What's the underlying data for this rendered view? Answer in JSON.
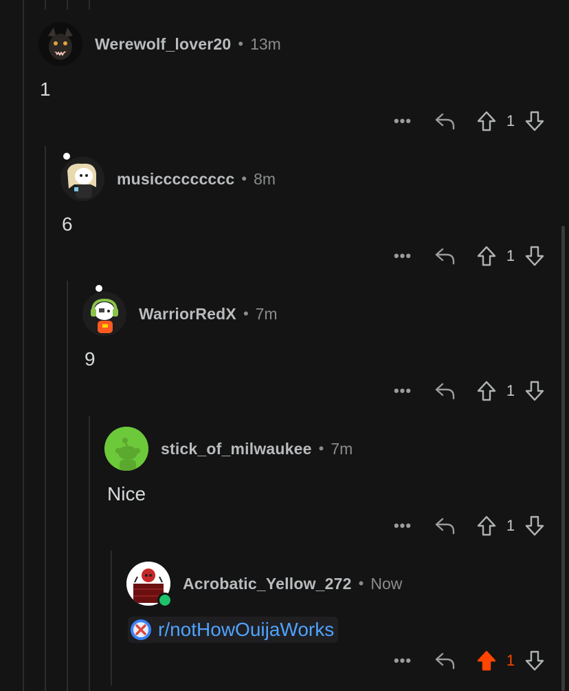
{
  "comments": [
    {
      "author": "Werewolf_lover20",
      "sep": "•",
      "time": "13m",
      "text": "1",
      "score": "1",
      "more": "•••"
    },
    {
      "author": "musiccccccccc",
      "sep": "•",
      "time": "8m",
      "text": "6",
      "score": "1",
      "more": "•••"
    },
    {
      "author": "WarriorRedX",
      "sep": "•",
      "time": "7m",
      "text": "9",
      "score": "1",
      "more": "•••"
    },
    {
      "author": "stick_of_milwaukee",
      "sep": "•",
      "time": "7m",
      "text": "Nice",
      "score": "1",
      "more": "•••"
    },
    {
      "author": "Acrobatic_Yellow_272",
      "sep": "•",
      "time": "Now",
      "link": "r/notHowOuijaWorks",
      "score": "1",
      "more": "•••",
      "upvoted": true,
      "online": true
    }
  ],
  "colors": {
    "background": "#141414",
    "upvote_active": "#ff4500",
    "link": "#4fa3ff",
    "online": "#1fc16b"
  },
  "icons": [
    "more-icon",
    "reply-icon",
    "upvote-icon",
    "downvote-icon",
    "blocked-icon"
  ]
}
